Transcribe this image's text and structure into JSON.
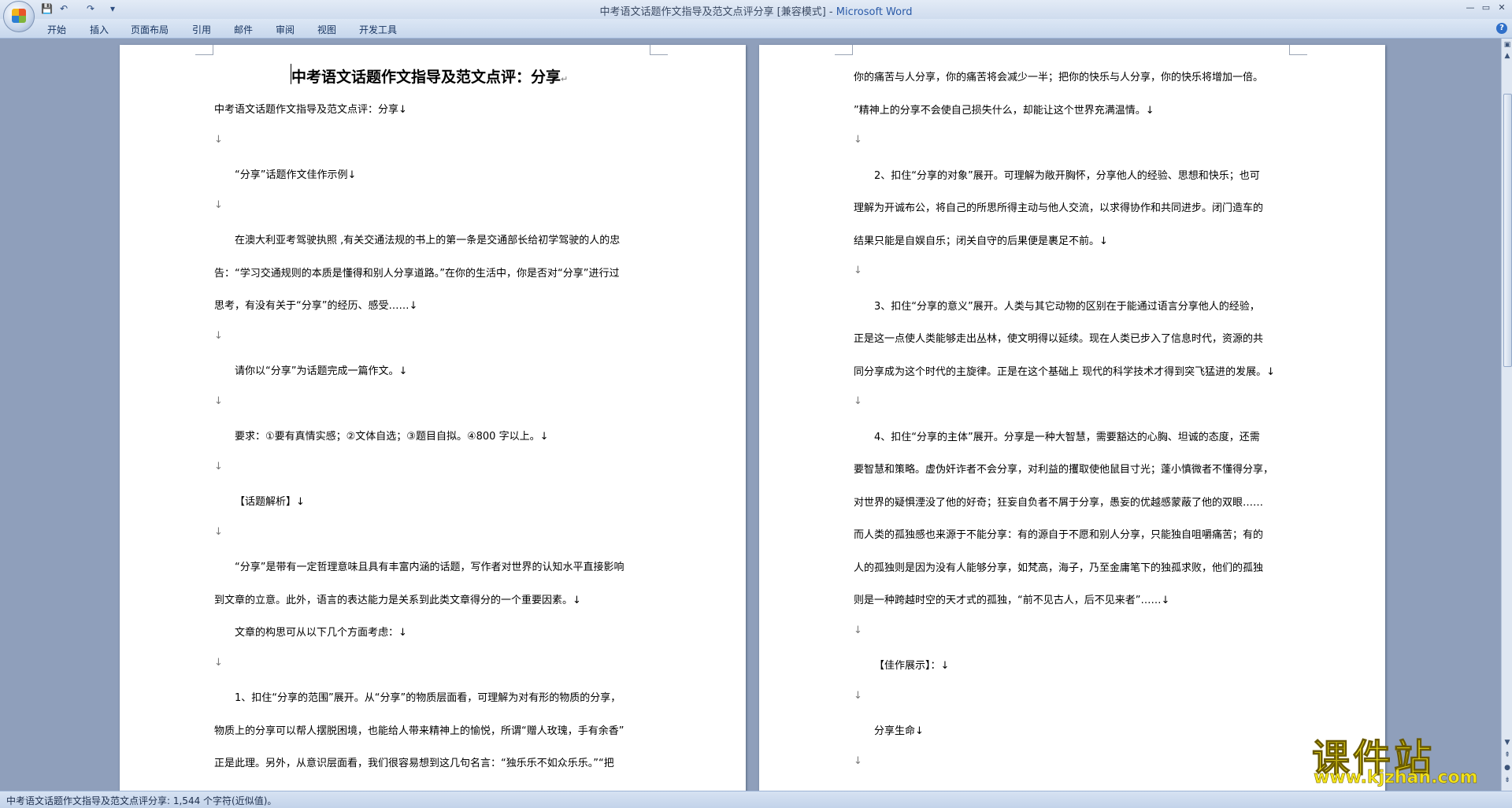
{
  "window": {
    "title": "中考语文话题作文指导及范文点评分享 [兼容模式] - ",
    "app_name": "Microsoft Word"
  },
  "quick_access": {
    "save": "💾",
    "undo": "↶",
    "redo": "↷",
    "more": "▾"
  },
  "window_controls": {
    "minimize": "—",
    "maximize": "▭",
    "close": "✕"
  },
  "ribbon_tabs": [
    "开始",
    "插入",
    "页面布局",
    "引用",
    "邮件",
    "审阅",
    "视图",
    "开发工具"
  ],
  "help_label": "?",
  "page1": {
    "heading": "中考语文话题作文指导及范文点评：分享",
    "heading_mark": "↵",
    "lines": [
      "中考语文话题作文指导及范文点评：分享↓",
      "↓",
      "“分享”话题作文佳作示例↓",
      "↓",
      "在澳大利亚考驾驶执照 ,有关交通法规的书上的第一条是交通部长给初学驾驶的人的忠",
      "告：“学习交通规则的本质是懂得和别人分享道路。”在你的生活中，你是否对“分享”进行过",
      "思考，有没有关于“分享”的经历、感受……↓",
      "↓",
      "请你以“分享”为话题完成一篇作文。↓",
      "↓",
      "要求：①要有真情实感；②文体自选；③题目自拟。④800 字以上。↓",
      "↓",
      "【话题解析】↓",
      "↓",
      "“分享”是带有一定哲理意味且具有丰富内涵的话题，写作者对世界的认知水平直接影响",
      "到文章的立意。此外，语言的表达能力是关系到此类文章得分的一个重要因素。↓",
      "文章的构思可从以下几个方面考虑：↓",
      "↓",
      "1、扣住“分享的范围”展开。从“分享”的物质层面看，可理解为对有形的物质的分享，",
      "物质上的分享可以帮人摆脱困境，也能给人带来精神上的愉悦，所谓“赠人玫瑰，手有余香”",
      "正是此理。另外，从意识层面看，我们很容易想到这几句名言：“独乐乐不如众乐乐。”“把"
    ]
  },
  "page2": {
    "lines": [
      "你的痛苦与人分享，你的痛苦将会减少一半；把你的快乐与人分享，你的快乐将增加一倍。",
      "”精神上的分享不会使自己损失什么，却能让这个世界充满温情。↓",
      "↓",
      "2、扣住“分享的对象”展开。可理解为敞开胸怀，分享他人的经验、思想和快乐；也可",
      "理解为开诚布公，将自己的所思所得主动与他人交流，以求得协作和共同进步。闭门造车的",
      "结果只能是自娱自乐；闭关自守的后果便是裹足不前。↓",
      "↓",
      "3、扣住“分享的意义”展开。人类与其它动物的区别在于能通过语言分享他人的经验，",
      "正是这一点使人类能够走出丛林，使文明得以延续。现在人类已步入了信息时代，资源的共",
      "同分享成为这个时代的主旋律。正是在这个基础上 现代的科学技术才得到突飞猛进的发展。↓",
      "↓",
      "4、扣住“分享的主体”展开。分享是一种大智慧，需要豁达的心胸、坦诚的态度，还需",
      "要智慧和策略。虚伪奸诈者不会分享，对利益的攫取使他鼠目寸光；蓬小慎微者不懂得分享，",
      "对世界的疑惧湮没了他的好奇；狂妄自负者不屑于分享，愚妄的优越感蒙蔽了他的双眼……",
      "而人类的孤独感也来源于不能分享：有的源自于不愿和别人分享，只能独自咀嚼痛苦；有的",
      "人的孤独则是因为没有人能够分享，如梵高，海子，乃至金庸笔下的独孤求败，他们的孤独",
      "则是一种跨越时空的天才式的孤独，“前不见古人，后不见来者”……↓",
      "↓",
      "【佳作展示】：↓",
      "↓",
      "分享生命↓",
      "↓"
    ]
  },
  "status_bar": {
    "text": "中考语文话题作文指导及范文点评分享: 1,544 个字符(近似值)。"
  },
  "watermark": {
    "main": "课件站",
    "url": "www.kjzhan.com"
  }
}
